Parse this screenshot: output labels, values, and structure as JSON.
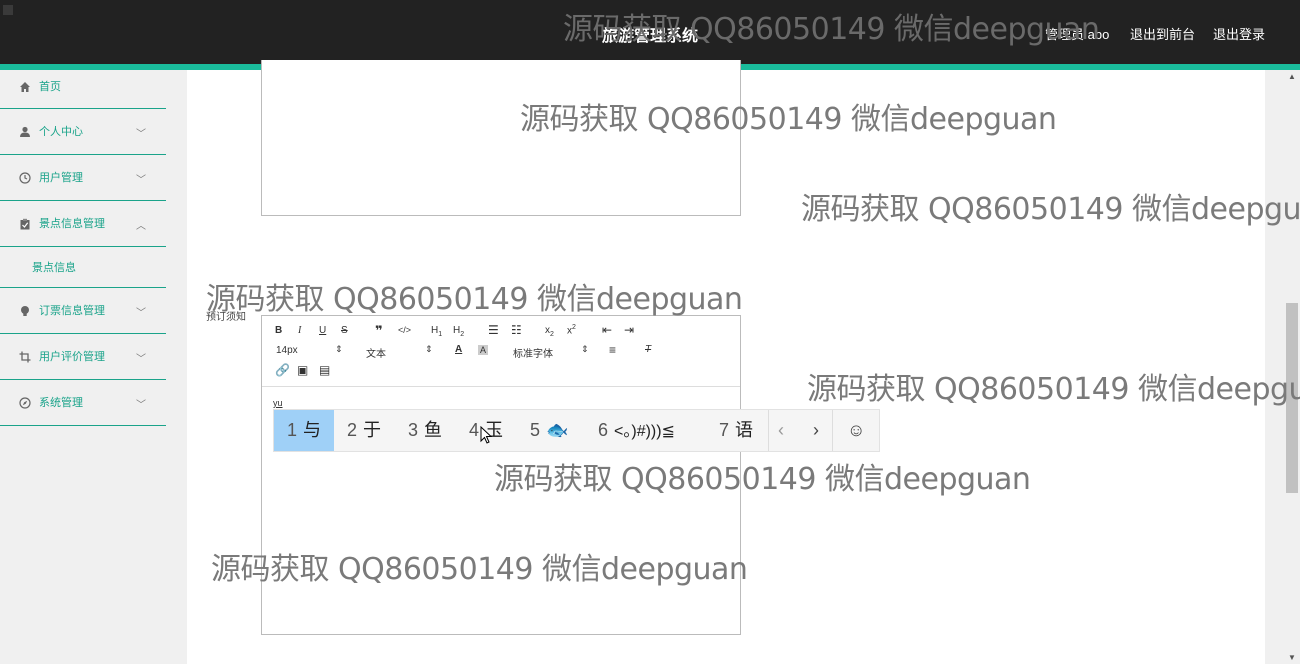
{
  "header": {
    "title": "旅游管理系统",
    "user": "管理员 abo",
    "to_front": "退出到前台",
    "logout": "退出登录"
  },
  "sidebar": {
    "items": [
      {
        "label": "首页",
        "icon": "home-icon"
      },
      {
        "label": "个人中心",
        "icon": "user-icon"
      },
      {
        "label": "用户管理",
        "icon": "clock-icon"
      },
      {
        "label": "景点信息管理",
        "icon": "clipboard-icon",
        "expanded": true
      },
      {
        "label": "景点信息"
      },
      {
        "label": "订票信息管理",
        "icon": "bulb-icon"
      },
      {
        "label": "用户评价管理",
        "icon": "crop-icon"
      },
      {
        "label": "系统管理",
        "icon": "compass-icon"
      }
    ]
  },
  "form": {
    "label": "预订须知",
    "typed": "yu"
  },
  "toolbar": {
    "font_size": "14px",
    "text_type": "文本",
    "font_family": "标准字体"
  },
  "ime": {
    "candidates": [
      {
        "num": "1",
        "text": "与"
      },
      {
        "num": "2",
        "text": "于"
      },
      {
        "num": "3",
        "text": "鱼"
      },
      {
        "num": "4",
        "text": "玉"
      },
      {
        "num": "5",
        "text": "🐟"
      },
      {
        "num": "6",
        "text": "<。)#)))≦"
      },
      {
        "num": "7",
        "text": "语"
      }
    ]
  },
  "watermark": "源码获取 QQ86050149 微信deepguan",
  "colors": {
    "accent": "#1abc9c",
    "header_bg": "#222222",
    "candidate_highlight": "#9fd0f7"
  }
}
